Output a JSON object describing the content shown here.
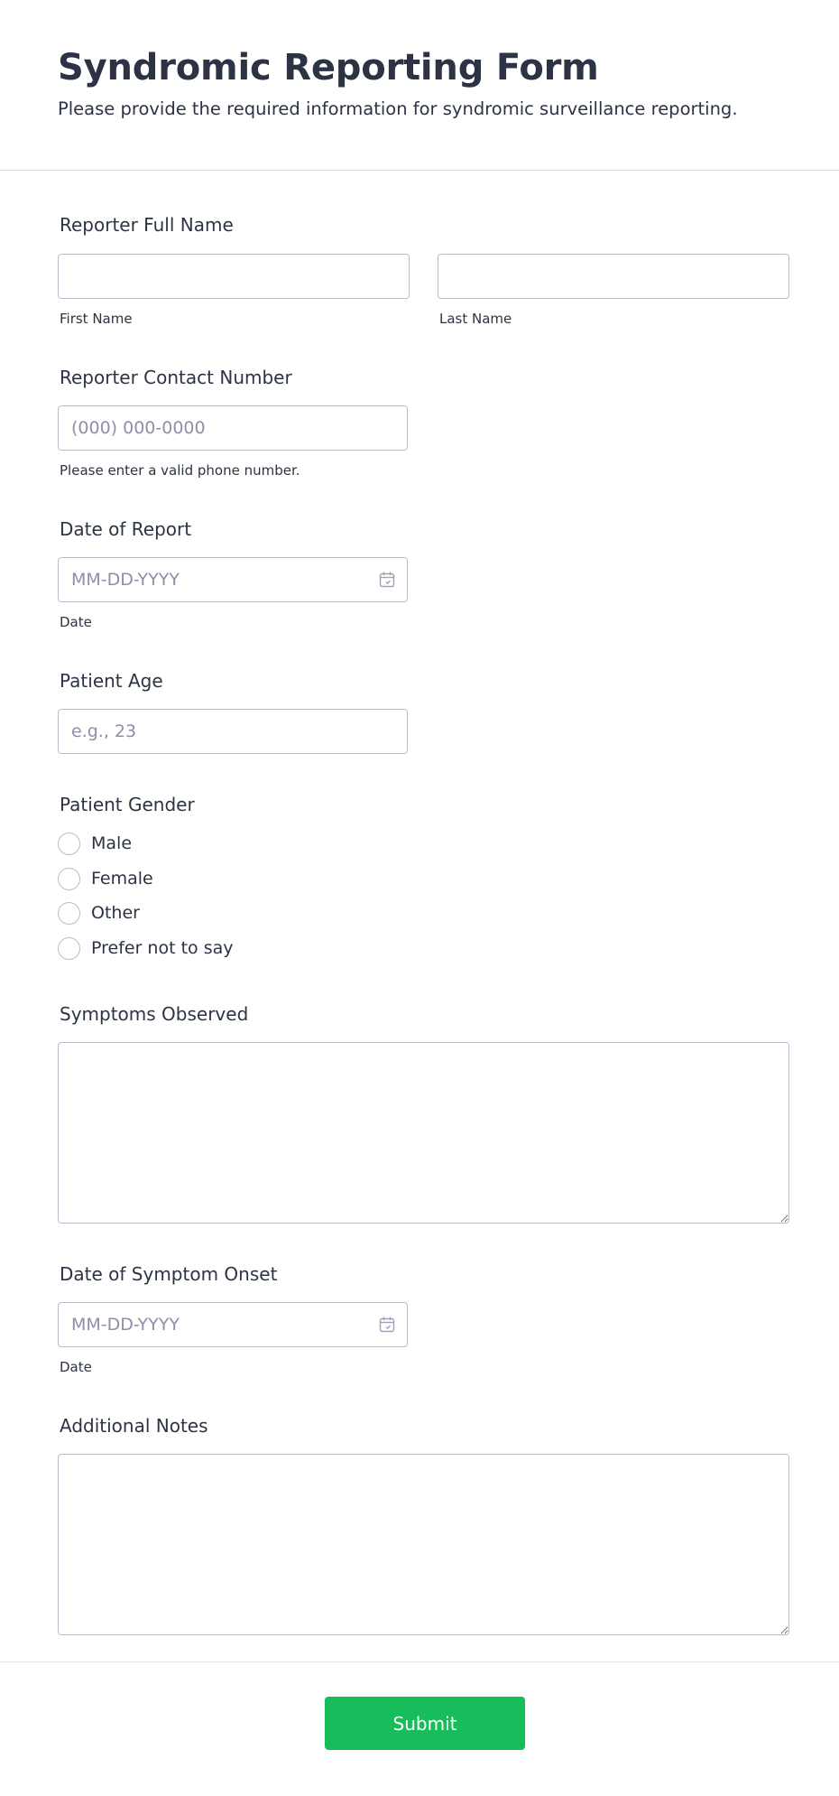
{
  "form": {
    "title": "Syndromic Reporting Form",
    "description": "Please provide the required information for syndromic surveillance reporting.",
    "submit_label": "Submit",
    "accent_color": "#18bd5b"
  },
  "fields": {
    "reporter_name": {
      "label": "Reporter Full Name",
      "first_sublabel": "First Name",
      "last_sublabel": "Last Name",
      "first_value": "",
      "last_value": ""
    },
    "contact_number": {
      "label": "Reporter Contact Number",
      "placeholder": "(000) 000-0000",
      "sublabel": "Please enter a valid phone number.",
      "value": ""
    },
    "report_date": {
      "label": "Date of Report",
      "placeholder": "MM-DD-YYYY",
      "sublabel": "Date",
      "icon": "calendar-icon"
    },
    "patient_age": {
      "label": "Patient Age",
      "placeholder": "e.g., 23",
      "value": ""
    },
    "patient_gender": {
      "label": "Patient Gender",
      "options": [
        "Male",
        "Female",
        "Other",
        "Prefer not to say"
      ],
      "selected": null
    },
    "symptoms": {
      "label": "Symptoms Observed",
      "value": ""
    },
    "onset_date": {
      "label": "Date of Symptom Onset",
      "placeholder": "MM-DD-YYYY",
      "sublabel": "Date",
      "icon": "calendar-icon"
    },
    "notes": {
      "label": "Additional Notes",
      "value": ""
    }
  }
}
